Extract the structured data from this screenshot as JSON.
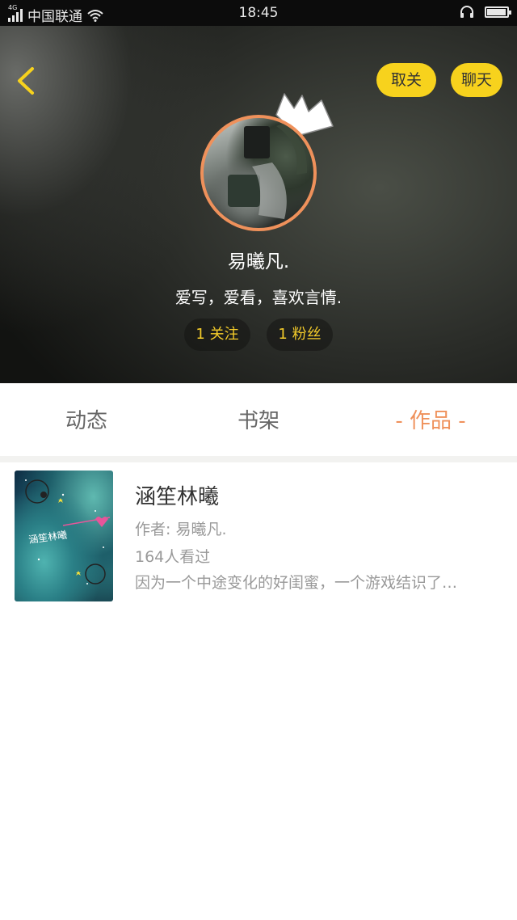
{
  "status_bar": {
    "network": "4G",
    "carrier": "中国联通",
    "time": "18:45",
    "battery_level": 0.95,
    "icons": [
      "signal-icon",
      "wifi-icon",
      "headset-icon",
      "battery-icon"
    ]
  },
  "header": {
    "back_icon": "chevron-left-icon",
    "unfollow_label": "取关",
    "chat_label": "聊天",
    "nickname": "易曦凡.",
    "bio": "爱写，爱看，喜欢言情.",
    "following": "1 关注",
    "followers": "1 粉丝",
    "colors": {
      "button_yellow": "#f7d21d",
      "avatar_ring": "#ef915b",
      "stat_text": "#f3cb2a"
    }
  },
  "tabs": [
    {
      "label": "动态"
    },
    {
      "label": "书架"
    },
    {
      "label": "- 作品 -",
      "active": true
    }
  ],
  "works": [
    {
      "title": "涵笙林曦",
      "author": "作者: 易曦凡.",
      "views": "164人看过",
      "description": "因为一个中途变化的好闺蜜，一个游戏结识了…",
      "cover_text": "涵笙林曦"
    }
  ],
  "accent_color": "#ef915b"
}
